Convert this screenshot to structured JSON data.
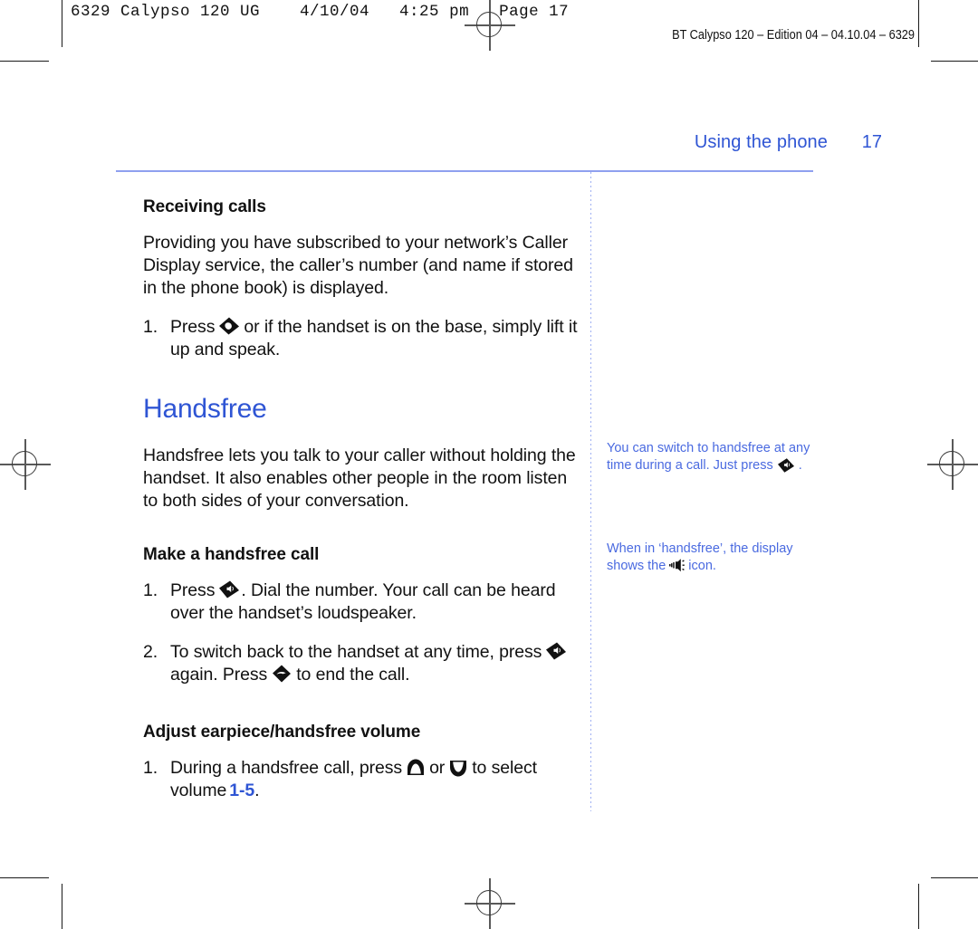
{
  "imposition": {
    "job_slug": "6329 Calypso 120 UG    4/10/04   4:25 pm   Page 17",
    "edition_line": "BT Calypso 120 – Edition 04 – 04.10.04 – 6329"
  },
  "page": {
    "running_head": "Using the phone",
    "folio": "17",
    "accent_color": "#2f55d4",
    "rule_color": "#8fa0ef"
  },
  "main": {
    "section_receiving": {
      "heading": "Receiving calls",
      "intro": "Providing you have subscribed to your network’s Caller Display service, the caller’s number (and name if stored in the phone book) is displayed.",
      "steps": [
        {
          "num": "1.",
          "before": "Press",
          "icon": "talk-key-icon",
          "after": "or if the handset is on the base, simply lift it up and speak."
        }
      ]
    },
    "chapter_heading": "Handsfree",
    "chapter_intro": "Handsfree lets you talk to your caller without holding the handset. It also enables other people in the room listen to both sides of your conversation.",
    "section_make_call": {
      "heading": "Make a handsfree call",
      "steps": [
        {
          "num": "1.",
          "before": "Press",
          "icon": "handsfree-key-icon",
          "after": ". Dial the number. Your call can be heard over the handset’s loudspeaker."
        },
        {
          "num": "2.",
          "before": "To switch back to the handset at any time, press",
          "icon": "handsfree-key-icon",
          "mid": "again. Press",
          "icon2": "end-call-key-icon",
          "after": "to end the call."
        }
      ]
    },
    "section_volume": {
      "heading": "Adjust earpiece/handsfree volume",
      "steps": [
        {
          "num": "1.",
          "before": "During a handsfree call, press",
          "icon": "volume-up-key-icon",
          "mid": "or",
          "icon2": "volume-down-key-icon",
          "after": "to select volume",
          "value": "1-5",
          "end": "."
        }
      ]
    }
  },
  "sidebar": {
    "notes": [
      {
        "before": "You can switch to handsfree at any time during a call. Just press",
        "icon": "handsfree-key-icon",
        "after": "."
      },
      {
        "before": "When in ‘handsfree’, the display shows the",
        "icon": "speaker-display-icon",
        "after": "icon."
      }
    ]
  }
}
